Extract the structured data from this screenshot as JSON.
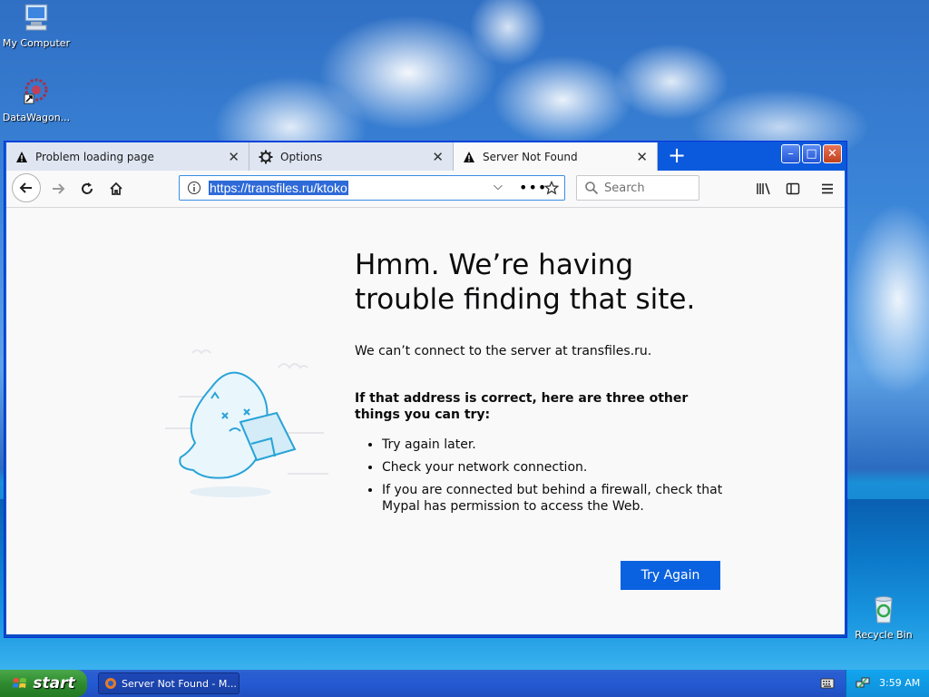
{
  "desktop": {
    "icons": [
      {
        "label": "My Computer"
      },
      {
        "label": "DataWagon..."
      },
      {
        "label": "Recycle Bin"
      }
    ]
  },
  "browser": {
    "tabs": [
      {
        "label": "Problem loading page",
        "icon": "warning-icon"
      },
      {
        "label": "Options",
        "icon": "gear-icon"
      },
      {
        "label": "Server Not Found",
        "icon": "warning-icon"
      }
    ],
    "window_buttons": {
      "minimize": "–",
      "maximize": "□",
      "close": "✕"
    },
    "url": "https://transfiles.ru/ktoko",
    "search_placeholder": "Search"
  },
  "page": {
    "heading": "Hmm. We’re having trouble finding that site.",
    "description": "We can’t connect to the server at transfiles.ru.",
    "subheading": "If that address is correct, here are three other things you can try:",
    "tips": [
      "Try again later.",
      "Check your network connection.",
      "If you are connected but behind a firewall, check that Mypal has permission to access the Web."
    ],
    "try_again_label": "Try Again"
  },
  "taskbar": {
    "start_label": "start",
    "task_label": "Server Not Found - M...",
    "clock": "3:59 AM"
  },
  "colors": {
    "accent": "#0a62e0",
    "taskbar": "#245ad3",
    "start": "#2f8b2f"
  }
}
